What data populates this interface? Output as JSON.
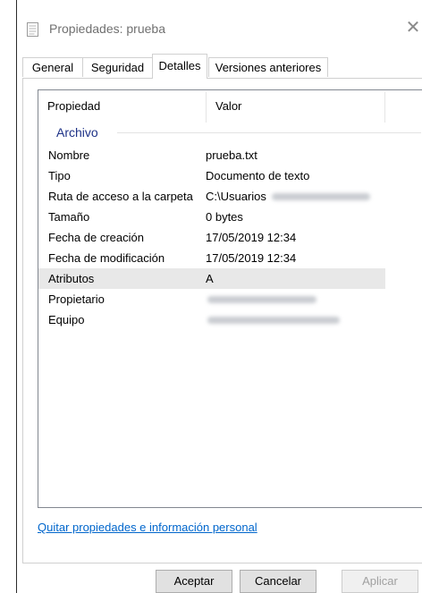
{
  "window": {
    "title": "Propiedades: prueba",
    "close_glyph": "✕",
    "icon": "document-icon"
  },
  "tabs": [
    {
      "label": "General"
    },
    {
      "label": "Seguridad"
    },
    {
      "label": "Detalles",
      "active": true
    },
    {
      "label": "Versiones anteriores"
    }
  ],
  "details": {
    "header": {
      "property": "Propiedad",
      "value": "Valor"
    },
    "group": "Archivo",
    "rows": [
      {
        "property": "Nombre",
        "value": "prueba.txt"
      },
      {
        "property": "Tipo",
        "value": "Documento de texto"
      },
      {
        "property": "Ruta de acceso a la carpeta",
        "value": "C:\\Usuarios",
        "blurred_suffix": true
      },
      {
        "property": "Tamaño",
        "value": "0 bytes"
      },
      {
        "property": "Fecha de creación",
        "value": "17/05/2019 12:34"
      },
      {
        "property": "Fecha de modificación",
        "value": "17/05/2019 12:34"
      },
      {
        "property": "Atributos",
        "value": "A",
        "selected": true
      },
      {
        "property": "Propietario",
        "value": "",
        "blurred": true
      },
      {
        "property": "Equipo",
        "value": "",
        "blurred": true
      }
    ]
  },
  "link": "Quitar propiedades e información personal",
  "buttons": {
    "ok": "Aceptar",
    "cancel": "Cancelar",
    "apply": "Aplicar"
  },
  "colors": {
    "group_header": "#1e3287",
    "link": "#0066cc",
    "selected_row": "#e8e8e8",
    "disabled_text": "#a0a0a0"
  }
}
